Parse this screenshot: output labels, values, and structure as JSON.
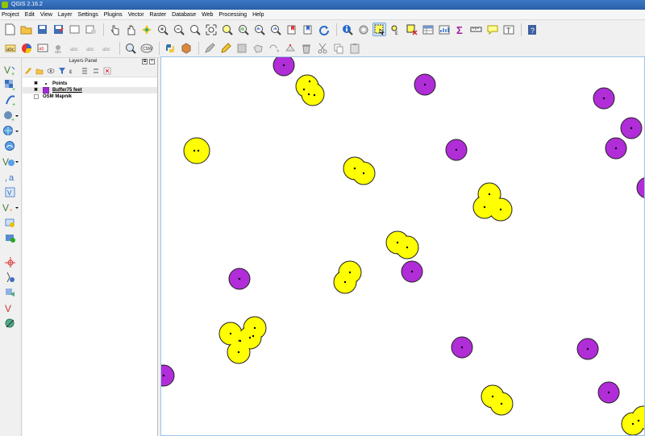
{
  "window": {
    "title": "QGIS 2.16.2"
  },
  "menu": {
    "items": [
      "Project",
      "Edit",
      "View",
      "Layer",
      "Settings",
      "Plugins",
      "Vector",
      "Raster",
      "Database",
      "Web",
      "Processing",
      "Help"
    ]
  },
  "layers_panel": {
    "title": "Layers Panel",
    "layers": [
      {
        "name": "Points",
        "checked": true,
        "symbol": "point-dot",
        "color": "#000000"
      },
      {
        "name": "Buffer75 feet",
        "checked": true,
        "symbol": "fill-square",
        "color": "#a329d6",
        "selected": true
      },
      {
        "name": "OSM Mapnik",
        "checked": false,
        "symbol": "raster"
      }
    ]
  },
  "map": {
    "colors": {
      "purple": "#b02dd8",
      "yellow": "#ffff00",
      "stroke": "#222222"
    }
  }
}
